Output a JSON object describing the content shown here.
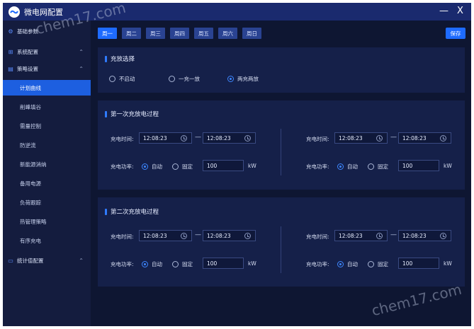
{
  "app": {
    "title": "微电网配置",
    "minimize": "—",
    "close": "X"
  },
  "watermark": {
    "top": "chem17.com",
    "bottom": "chem17.com"
  },
  "sidebar": {
    "basic": "基础参数",
    "system": "系统配置",
    "strategy": "策略设置",
    "strategy_items": [
      "计划曲线",
      "削峰填谷",
      "需量控制",
      "防逆流",
      "新能源消纳",
      "备用电源",
      "负荷跟踪",
      "热管理策略",
      "有序充电"
    ],
    "stats": "统计值配置"
  },
  "tabs": [
    "周一",
    "周二",
    "周三",
    "周四",
    "周五",
    "周六",
    "周日"
  ],
  "save_label": "保存",
  "charge_select": {
    "title": "充放选择",
    "options": [
      "不启动",
      "一充一放",
      "两充两放"
    ],
    "selected": "两充两放"
  },
  "process1": {
    "title": "第一次充放电过程",
    "left": {
      "time_label": "充电时间:",
      "start": "12:08:23",
      "end": "12:08:23",
      "power_label": "充电功率:",
      "auto": "自动",
      "fixed": "固定",
      "power": "100",
      "unit": "kW"
    },
    "right": {
      "time_label": "充电时间:",
      "start": "12:08:23",
      "end": "12:08:23",
      "power_label": "充电功率:",
      "auto": "自动",
      "fixed": "固定",
      "power": "100",
      "unit": "kW"
    }
  },
  "process2": {
    "title": "第二次充放电过程",
    "left": {
      "time_label": "充电时间:",
      "start": "12:08:23",
      "end": "12:08:23",
      "power_label": "充电功率:",
      "auto": "自动",
      "fixed": "固定",
      "power": "100",
      "unit": "kW"
    },
    "right": {
      "time_label": "充电时间:",
      "start": "12:08:23",
      "end": "12:08:23",
      "power_label": "充电功率:",
      "auto": "自动",
      "fixed": "固定",
      "power": "100",
      "unit": "kW"
    }
  },
  "colors": {
    "accent": "#1e6bff",
    "panel": "#152049",
    "background": "#0e1632",
    "titlebar": "#1a2a6e"
  }
}
